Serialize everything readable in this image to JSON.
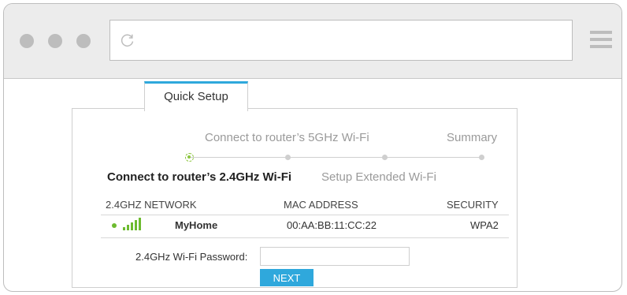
{
  "browser": {
    "icons": {
      "reload": "reload-icon",
      "menu": "hamburger-menu-icon"
    },
    "url": ""
  },
  "tab": {
    "label": "Quick Setup"
  },
  "steps": [
    {
      "label": "Connect to router’s 2.4GHz Wi-Fi",
      "active": true
    },
    {
      "label": "Connect to router’s 5GHz Wi-Fi",
      "active": false
    },
    {
      "label": "Setup Extended Wi-Fi",
      "active": false
    },
    {
      "label": "Summary",
      "active": false
    }
  ],
  "table": {
    "headers": {
      "network": "2.4GHZ NETWORK",
      "mac": "MAC ADDRESS",
      "security": "SECURITY"
    },
    "rows": [
      {
        "network": "MyHome",
        "mac": "00:AA:BB:11:CC:22",
        "security": "WPA2",
        "selected": true
      }
    ]
  },
  "password": {
    "label": "2.4GHz Wi-Fi Password:",
    "value": "",
    "placeholder": ""
  },
  "next_button": {
    "label": "NEXT"
  },
  "colors": {
    "accent": "#2fa8dc",
    "signal": "#6dbb2f",
    "chrome": "#ececec"
  }
}
